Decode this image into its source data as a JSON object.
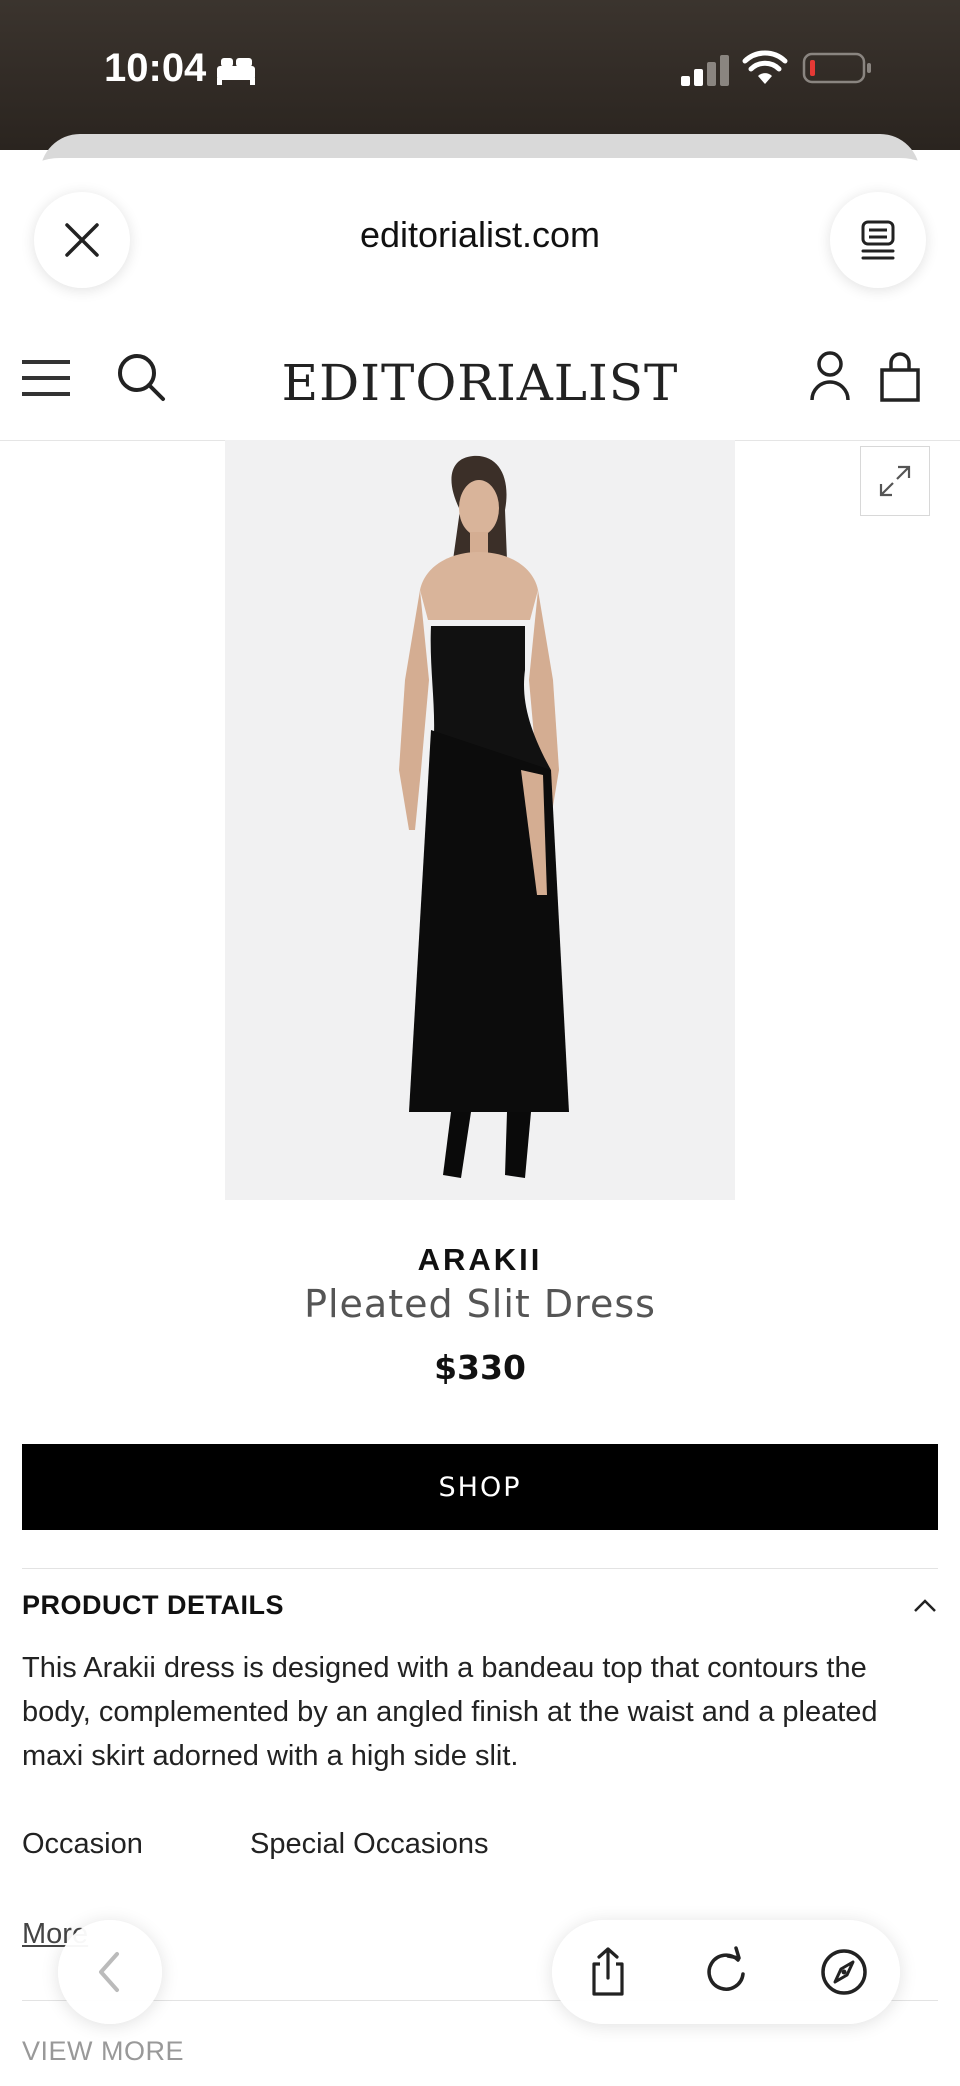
{
  "status_bar": {
    "time": "10:04",
    "icons": [
      "bed-icon",
      "signal-icon",
      "wifi-icon",
      "battery-icon"
    ],
    "battery_color": "#e53935"
  },
  "browser": {
    "url": "editorialist.com",
    "icons": [
      "close-icon",
      "reader-icon"
    ]
  },
  "site_header": {
    "logo": "EDITORIALIST",
    "icons": [
      "menu-icon",
      "search-icon",
      "user-icon",
      "bag-icon"
    ]
  },
  "product": {
    "brand": "ARAKII",
    "name": "Pleated Slit Dress",
    "price": "$330",
    "shop_label": "SHOP",
    "image_icon": "expand-icon"
  },
  "details": {
    "title": "PRODUCT DETAILS",
    "description": "This Arakii dress is designed with a bandeau top that contours the body, complemented by an angled finish at the waist and a pleated maxi skirt adorned with a high side slit.",
    "occasion_label": "Occasion",
    "occasion_value": "Special Occasions",
    "more_link": "More"
  },
  "footer": {
    "view_more": "VIEW MORE"
  },
  "bottom_toolbar": {
    "icons": [
      "back-icon",
      "share-icon",
      "reload-icon",
      "compass-icon"
    ]
  }
}
